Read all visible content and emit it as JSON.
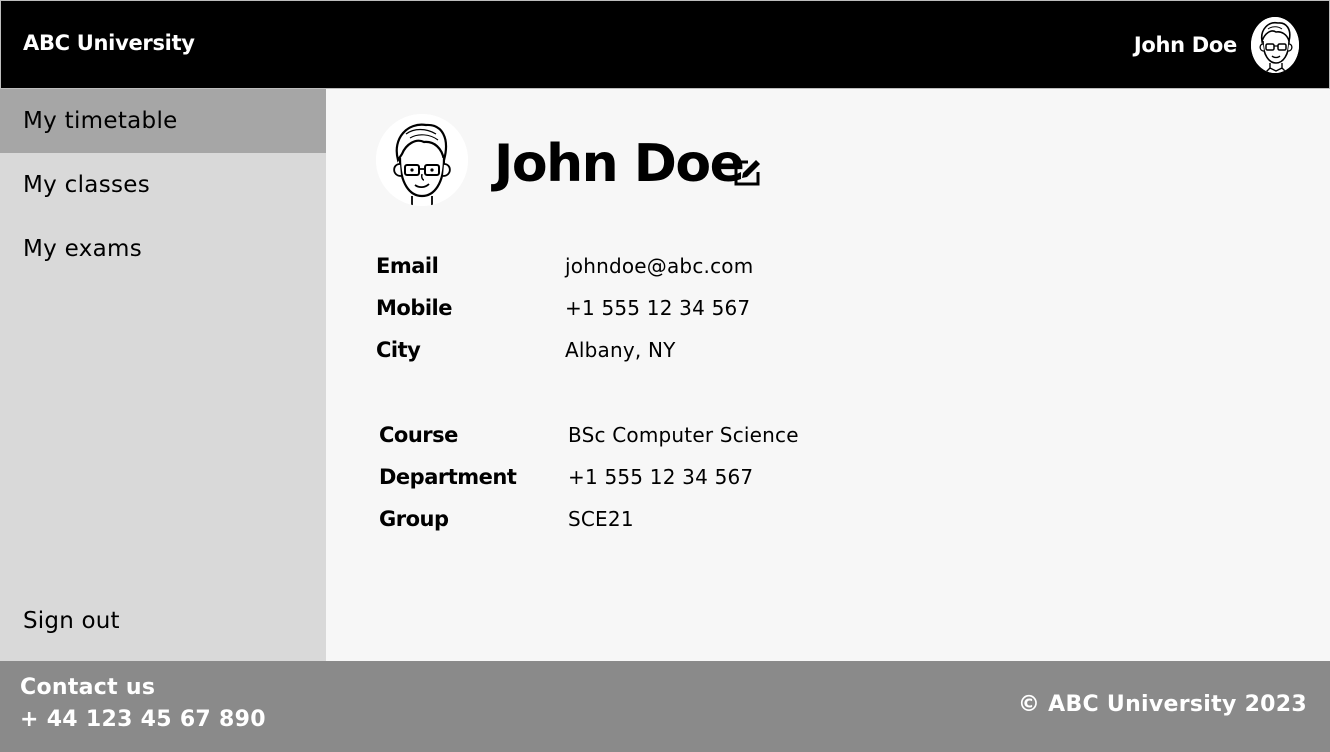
{
  "header": {
    "brand": "ABC University",
    "user_name": "John Doe",
    "avatar_icon": "user-avatar-icon"
  },
  "sidebar": {
    "items": [
      {
        "label": "My timetable",
        "active": true
      },
      {
        "label": "My classes",
        "active": false
      },
      {
        "label": "My exams",
        "active": false
      }
    ],
    "signout_label": "Sign out"
  },
  "profile": {
    "name": "John Doe",
    "edit_icon": "edit-icon",
    "contact": [
      {
        "label": "Email",
        "value": "johndoe@abc.com"
      },
      {
        "label": "Mobile",
        "value": "+1 555 12 34 567"
      },
      {
        "label": "City",
        "value": "Albany, NY"
      }
    ],
    "academic": [
      {
        "label": "Course",
        "value": "BSc Computer Science"
      },
      {
        "label": "Department",
        "value": "+1 555 12 34 567"
      },
      {
        "label": "Group",
        "value": "SCE21"
      }
    ]
  },
  "footer": {
    "contact_title": "Contact us",
    "contact_phone": "+ 44 123 45 67 890",
    "copyright": "© ABC University 2023"
  },
  "colors": {
    "header_bg": "#000000",
    "sidebar_bg": "#d9d9d9",
    "sidebar_active_bg": "#a6a6a6",
    "main_bg": "#f7f7f7",
    "footer_bg": "#8a8a8a"
  }
}
